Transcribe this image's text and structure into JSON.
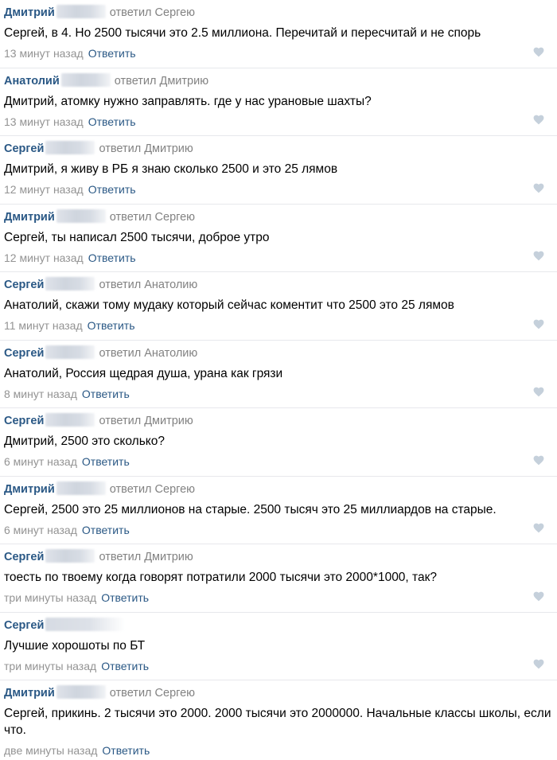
{
  "reply_label": "Ответить",
  "comments": [
    {
      "author": "Дмитрий",
      "reply_to": "ответил Сергею",
      "text": "Сергей, в 4. Но 2500 тысячи это 2.5 миллиона. Перечитай и пересчитай и не спорь",
      "time": "13 минут назад"
    },
    {
      "author": "Анатолий",
      "reply_to": "ответил Дмитрию",
      "text": "Дмитрий, атомку нужно заправлять. где у нас урановые шахты?",
      "time": "13 минут назад"
    },
    {
      "author": "Сергей",
      "reply_to": "ответил Дмитрию",
      "text": "Дмитрий, я живу в РБ я знаю сколько 2500 и это 25 лямов",
      "time": "12 минут назад"
    },
    {
      "author": "Дмитрий",
      "reply_to": "ответил Сергею",
      "text": "Сергей, ты написал 2500 тысячи, доброе утро",
      "time": "12 минут назад"
    },
    {
      "author": "Сергей",
      "reply_to": "ответил Анатолию",
      "text": "Анатолий, скажи тому мудаку который сейчас коментит что 2500 это 25 лямов",
      "time": "11 минут назад"
    },
    {
      "author": "Сергей",
      "reply_to": "ответил Анатолию",
      "text": "Анатолий, Россия щедрая душа, урана как грязи",
      "time": "8 минут назад"
    },
    {
      "author": "Сергей",
      "reply_to": "ответил Дмитрию",
      "text": "Дмитрий, 2500 это сколько?",
      "time": "6 минут назад"
    },
    {
      "author": "Дмитрий",
      "reply_to": "ответил Сергею",
      "text": "Сергей, 2500 это 25 миллионов на старые. 2500 тысяч это 25 миллиардов на старые.",
      "time": "6 минут назад"
    },
    {
      "author": "Сергей",
      "reply_to": "ответил Дмитрию",
      "text": "тоесть по твоему когда говорят потратили 2000 тысячи это 2000*1000, так?",
      "time": "три минуты назад"
    },
    {
      "author": "Сергей",
      "reply_to": "",
      "text": "Лучшие хорошоты по БТ",
      "time": "три минуты назад"
    },
    {
      "author": "Дмитрий",
      "reply_to": "ответил Сергею",
      "text": "Сергей, прикинь. 2 тысячи это 2000. 2000 тысячи это 2000000. Начальные классы школы, если что.",
      "time": "две минуты назад"
    }
  ]
}
